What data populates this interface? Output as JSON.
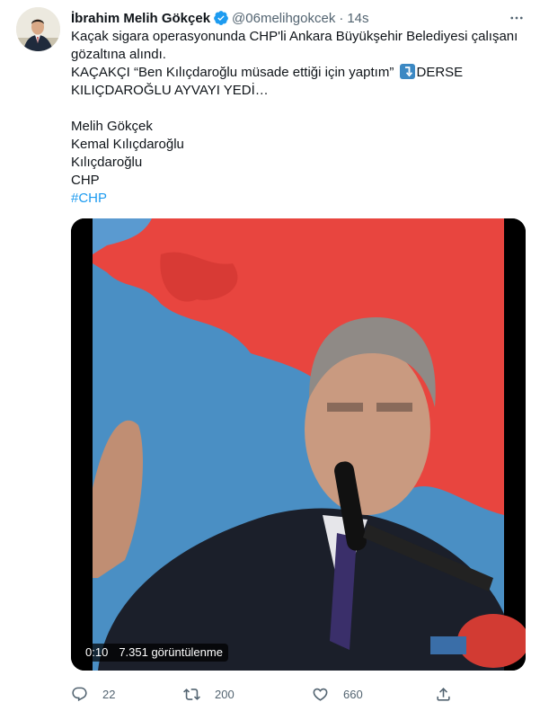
{
  "author": {
    "name": "İbrahim Melih Gökçek",
    "handle": "@06melihgokcek",
    "time": "14s",
    "verified": true
  },
  "tweet": {
    "line1": "Kaçak sigara operasyonunda CHP'li Ankara Büyükşehir Belediyesi çalışanı",
    "line2": "gözaltına alındı.",
    "line3a": "KAÇAKÇI “Ben Kılıçdaroğlu müsade ettiği için yaptım”",
    "line3b": "DERSE",
    "line4": "KILIÇDAROĞLU AYVAYI YEDİ…",
    "tags": [
      "Melih Gökçek",
      "Kemal Kılıçdaroğlu",
      "Kılıçdaroğlu",
      "CHP"
    ],
    "hashtag": "#CHP"
  },
  "video": {
    "duration": "0:10",
    "views": "7.351 görüntülenme"
  },
  "actions": {
    "replies": "22",
    "retweets": "200",
    "likes": "660"
  },
  "colors": {
    "accent": "#1d9bf0",
    "muted": "#536471",
    "emoji_blue": "#3b88c3"
  },
  "icons": [
    "verified-badge-icon",
    "more-options-icon",
    "redirect-arrow-emoji-icon",
    "reply-icon",
    "retweet-icon",
    "like-icon",
    "share-icon"
  ]
}
